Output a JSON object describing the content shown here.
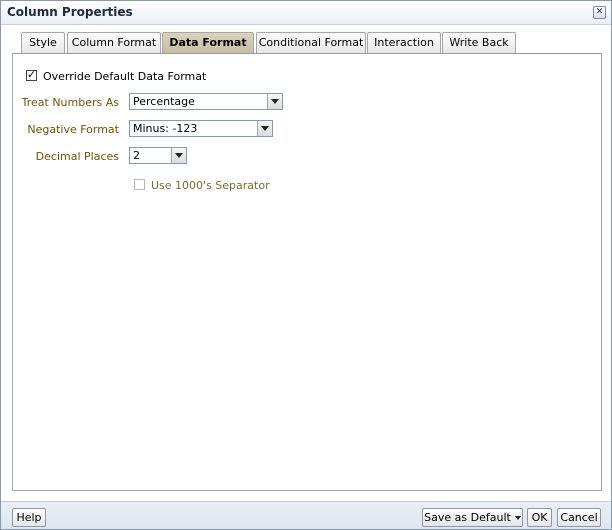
{
  "dialog": {
    "title": "Column Properties",
    "close_glyph": "✕"
  },
  "tabs": [
    {
      "label": "Style",
      "active": false
    },
    {
      "label": "Column Format",
      "active": false
    },
    {
      "label": "Data Format",
      "active": true
    },
    {
      "label": "Conditional Format",
      "active": false
    },
    {
      "label": "Interaction",
      "active": false
    },
    {
      "label": "Write Back",
      "active": false
    }
  ],
  "form": {
    "override": {
      "label": "Override Default Data Format",
      "checked": true,
      "mark": "✓"
    },
    "treat_numbers": {
      "label": "Treat Numbers As",
      "value": "Percentage"
    },
    "negative_format": {
      "label": "Negative Format",
      "value": "Minus: -123"
    },
    "decimal_places": {
      "label": "Decimal Places",
      "value": "2"
    },
    "separator": {
      "label": "Use 1000's Separator",
      "checked": false,
      "disabled": true
    }
  },
  "footer": {
    "help": "Help",
    "save_default": "Save as Default",
    "ok": "OK",
    "cancel": "Cancel"
  },
  "colors": {
    "label_brown": "#6e5209",
    "active_tab": "#c4bca4",
    "border_blue": "#7f9db9"
  }
}
